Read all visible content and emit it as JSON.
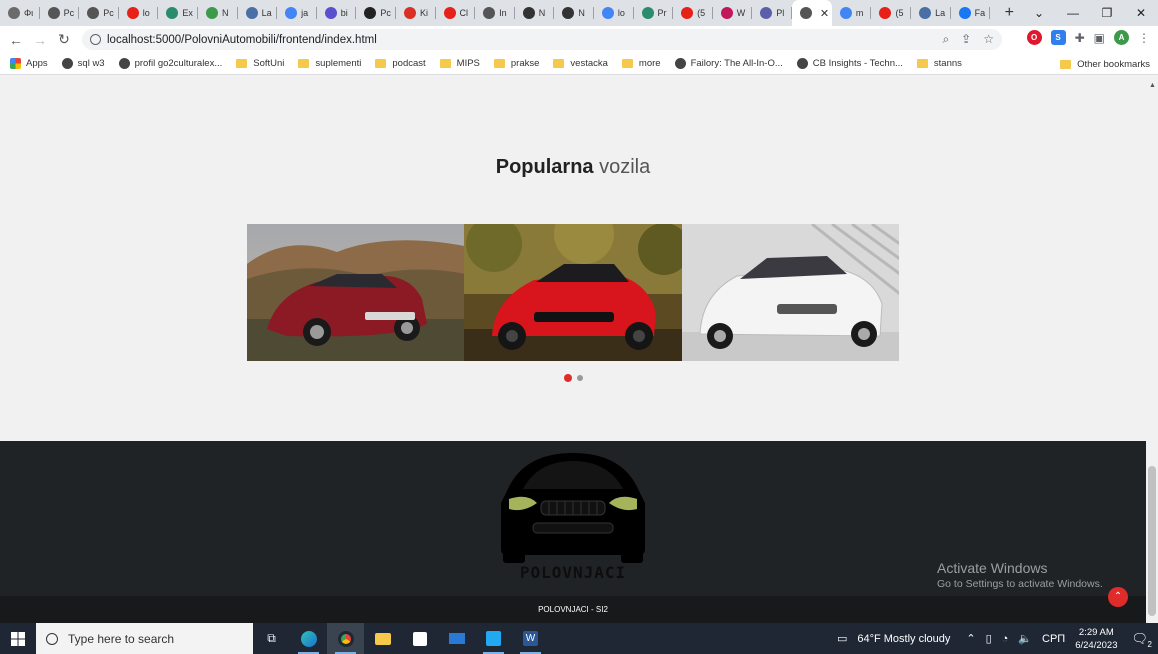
{
  "browser": {
    "tabs": [
      {
        "label": "Φι",
        "color": "#6b6b6b"
      },
      {
        "label": "Pc",
        "color": "#555"
      },
      {
        "label": "Pc",
        "color": "#555"
      },
      {
        "label": "lo",
        "color": "#e62117"
      },
      {
        "label": "Ex",
        "color": "#2a8c6d"
      },
      {
        "label": "N",
        "color": "#3c9a4a"
      },
      {
        "label": "La",
        "color": "#4a6fa5"
      },
      {
        "label": "ja",
        "color": "#4285f4"
      },
      {
        "label": "bi",
        "color": "#5a4fcf"
      },
      {
        "label": "Pc",
        "color": "#222"
      },
      {
        "label": "Ki",
        "color": "#d93025"
      },
      {
        "label": "Cl",
        "color": "#e62117"
      },
      {
        "label": "In",
        "color": "#555"
      },
      {
        "label": "N",
        "color": "#333"
      },
      {
        "label": "N",
        "color": "#333"
      },
      {
        "label": "lo",
        "color": "#4285f4"
      },
      {
        "label": "Pr",
        "color": "#2a8c6d"
      },
      {
        "label": "(5",
        "color": "#e62117"
      },
      {
        "label": "W",
        "color": "#c2185b"
      },
      {
        "label": "Pl",
        "color": "#5b5fa8"
      }
    ],
    "active_tab_close": "✕",
    "tabs_after": [
      {
        "label": "m",
        "color": "#4285f4"
      },
      {
        "label": "(5",
        "color": "#e62117"
      },
      {
        "label": "La",
        "color": "#4a6fa5"
      },
      {
        "label": "Fa",
        "color": "#1877f2"
      }
    ],
    "new_tab": "+",
    "url": "localhost:5000/PolovniAutomobili/frontend/index.html",
    "profile_initial": "A",
    "bookmarks": [
      {
        "label": "Apps",
        "type": "apps"
      },
      {
        "label": "sql w3",
        "type": "site"
      },
      {
        "label": "profil go2culturalex...",
        "type": "site"
      },
      {
        "label": "SoftUni",
        "type": "folder"
      },
      {
        "label": "suplementi",
        "type": "folder"
      },
      {
        "label": "podcast",
        "type": "folder"
      },
      {
        "label": "MIPS",
        "type": "folder"
      },
      {
        "label": "prakse",
        "type": "folder"
      },
      {
        "label": "vestacka",
        "type": "folder"
      },
      {
        "label": "more",
        "type": "folder"
      },
      {
        "label": "Failory: The All-In-O...",
        "type": "site"
      },
      {
        "label": "CB Insights - Techn...",
        "type": "site"
      },
      {
        "label": "stanns",
        "type": "folder"
      }
    ],
    "other_bookmarks": "Other bookmarks"
  },
  "page": {
    "section_title_bold": "Popularna",
    "section_title_light": "vozila",
    "carousel": {
      "slides": [
        {
          "name": "red sedan in desert hills",
          "color": "#8b1a24"
        },
        {
          "name": "red hatchback in forest",
          "color": "#d8141c"
        },
        {
          "name": "white sedan in showroom",
          "color": "#f2f2f2"
        }
      ],
      "dot_count": 2,
      "active_dot": 1
    },
    "footer": {
      "brand": "POLOVNJACI",
      "copyright": "POLOVNJACI - SI2"
    },
    "watermark_title": "Activate Windows",
    "watermark_sub": "Go to Settings to activate Windows."
  },
  "taskbar": {
    "search_placeholder": "Type here to search",
    "weather": "64°F  Mostly cloudy",
    "lang": "СРП",
    "time": "2:29 AM",
    "date": "6/24/2023",
    "notif_count": "2"
  }
}
